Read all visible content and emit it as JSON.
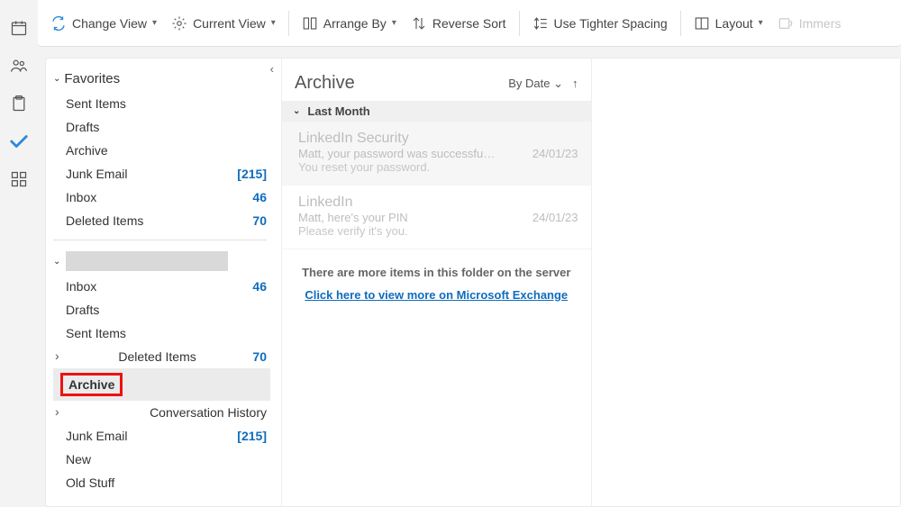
{
  "ribbon": {
    "change_view": "Change View",
    "current_view": "Current View",
    "arrange_by": "Arrange By",
    "reverse_sort": "Reverse Sort",
    "tighter_spacing": "Use Tighter Spacing",
    "layout": "Layout",
    "immersive": "Immers"
  },
  "folder_pane": {
    "favorites_label": "Favorites",
    "favorites": [
      {
        "name": "Sent Items",
        "count": ""
      },
      {
        "name": "Drafts",
        "count": ""
      },
      {
        "name": "Archive",
        "count": ""
      },
      {
        "name": "Junk Email",
        "count": "215",
        "bracket": true
      },
      {
        "name": "Inbox",
        "count": "46"
      },
      {
        "name": "Deleted Items",
        "count": "70"
      }
    ],
    "account_items": [
      {
        "name": "Inbox",
        "count": "46"
      },
      {
        "name": "Drafts",
        "count": ""
      },
      {
        "name": "Sent Items",
        "count": ""
      },
      {
        "name": "Deleted Items",
        "count": "70",
        "child": true
      },
      {
        "name": "Archive",
        "count": "",
        "selected": true,
        "highlight": true
      },
      {
        "name": "Conversation History",
        "count": "",
        "child": true
      },
      {
        "name": "Junk Email",
        "count": "215",
        "bracket": true
      },
      {
        "name": "New",
        "count": ""
      },
      {
        "name": "Old Stuff",
        "count": ""
      }
    ]
  },
  "message_pane": {
    "title": "Archive",
    "sort_label": "By Date",
    "group_label": "Last Month",
    "messages": [
      {
        "sender": "LinkedIn Security",
        "subject": "Matt, your password was successfu…",
        "preview": "You reset your password.",
        "date": "24/01/23"
      },
      {
        "sender": "LinkedIn",
        "subject": "Matt, here's your PIN",
        "preview": "Please verify it's you.",
        "date": "24/01/23"
      }
    ],
    "more_text": "There are more items in this folder on the server",
    "more_link": "Click here to view more on Microsoft Exchange"
  }
}
